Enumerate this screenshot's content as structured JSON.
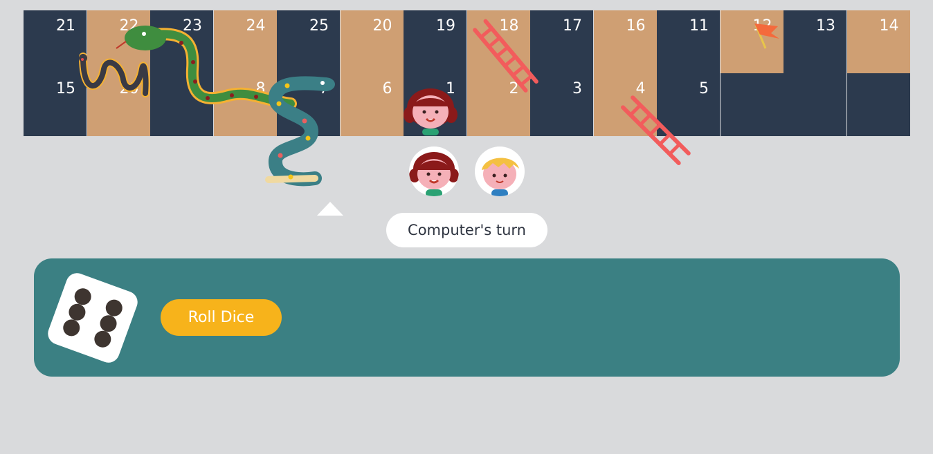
{
  "board": {
    "row1": [
      {
        "n": "21",
        "c": "dark"
      },
      {
        "n": "22",
        "c": "tan"
      },
      {
        "n": "23",
        "c": "dark"
      },
      {
        "n": "24",
        "c": "tan"
      },
      {
        "n": "25",
        "c": "dark"
      },
      {
        "n": "20",
        "c": "tan"
      },
      {
        "n": "19",
        "c": "dark"
      },
      {
        "n": "18",
        "c": "tan"
      },
      {
        "n": "17",
        "c": "dark"
      },
      {
        "n": "16",
        "c": "tan"
      },
      {
        "n": "11",
        "c": "dark"
      },
      {
        "n": "12",
        "c": "tan"
      },
      {
        "n": "13",
        "c": "dark"
      },
      {
        "n": "14",
        "c": "tan"
      }
    ],
    "row2": [
      {
        "n": "15",
        "c": "dark"
      },
      {
        "n": "20",
        "c": "tan"
      },
      {
        "n": "",
        "c": "dark"
      },
      {
        "n": "8",
        "c": "tan"
      },
      {
        "n": "7",
        "c": "dark"
      },
      {
        "n": "6",
        "c": "tan"
      },
      {
        "n": "1",
        "c": "dark"
      },
      {
        "n": "2",
        "c": "tan"
      },
      {
        "n": "3",
        "c": "dark"
      },
      {
        "n": "4",
        "c": "tan"
      },
      {
        "n": "5",
        "c": "dark"
      },
      {
        "n": "",
        "c": "dark"
      },
      {
        "n": "",
        "c": "dark"
      },
      {
        "n": "",
        "c": "dark"
      }
    ]
  },
  "players": [
    {
      "name": "girl-avatar",
      "icon": "girl-avatar-icon"
    },
    {
      "name": "boy-avatar",
      "icon": "boy-avatar-icon"
    }
  ],
  "status": {
    "turn_text": "Computer's turn"
  },
  "controls": {
    "roll_label": "Roll Dice",
    "dice_value": 6
  },
  "colors": {
    "dark_cell": "#2c3a4e",
    "tan_cell": "#cf9f73",
    "ladder": "#f25c5c",
    "panel": "#3b8083",
    "button": "#f7b31b",
    "background": "#d9dadc"
  }
}
